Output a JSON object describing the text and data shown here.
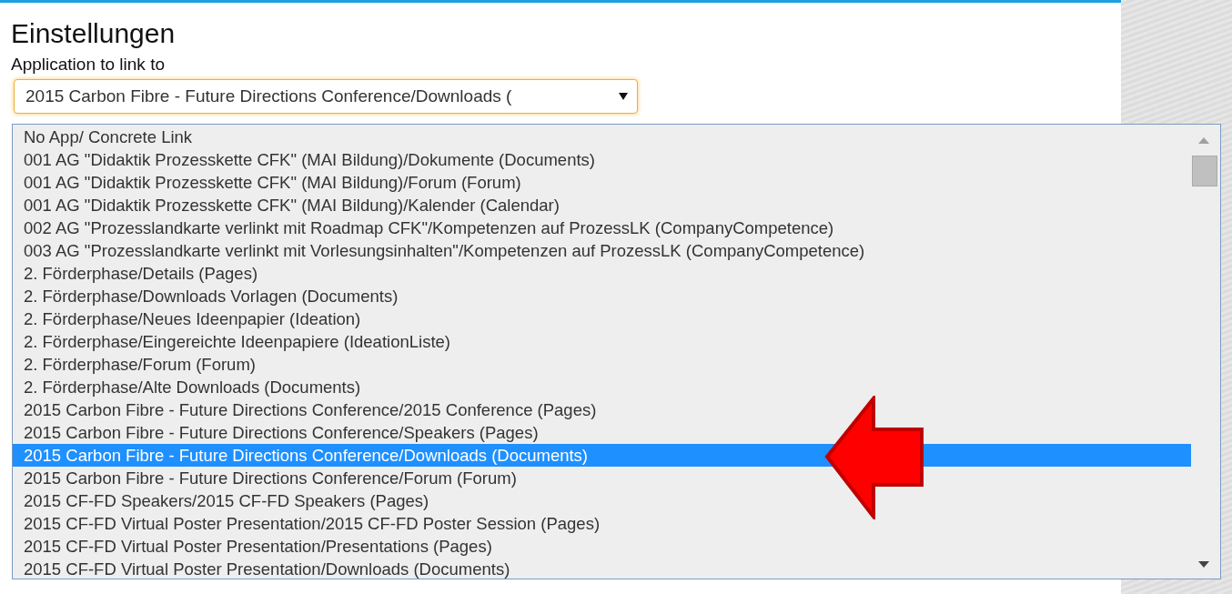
{
  "heading": "Einstellungen",
  "field": {
    "label": "Application to link to",
    "value": "2015 Carbon Fibre - Future Directions Conference/Downloads ("
  },
  "options": [
    {
      "label": "No App/ Concrete Link",
      "selected": false
    },
    {
      "label": "001 AG \"Didaktik Prozesskette CFK\" (MAI Bildung)/Dokumente (Documents)",
      "selected": false
    },
    {
      "label": "001 AG \"Didaktik Prozesskette CFK\" (MAI Bildung)/Forum (Forum)",
      "selected": false
    },
    {
      "label": "001 AG \"Didaktik Prozesskette CFK\" (MAI Bildung)/Kalender (Calendar)",
      "selected": false
    },
    {
      "label": "002 AG \"Prozesslandkarte verlinkt mit Roadmap CFK\"/Kompetenzen auf ProzessLK (CompanyCompetence)",
      "selected": false
    },
    {
      "label": "003 AG \"Prozesslandkarte verlinkt mit Vorlesungsinhalten\"/Kompetenzen auf ProzessLK (CompanyCompetence)",
      "selected": false
    },
    {
      "label": "2. Förderphase/Details (Pages)",
      "selected": false
    },
    {
      "label": "2. Förderphase/Downloads Vorlagen (Documents)",
      "selected": false
    },
    {
      "label": "2. Förderphase/Neues Ideenpapier (Ideation)",
      "selected": false
    },
    {
      "label": "2. Förderphase/Eingereichte Ideenpapiere (IdeationListe)",
      "selected": false
    },
    {
      "label": "2. Förderphase/Forum (Forum)",
      "selected": false
    },
    {
      "label": "2. Förderphase/Alte Downloads (Documents)",
      "selected": false
    },
    {
      "label": "2015 Carbon Fibre - Future Directions Conference/2015 Conference (Pages)",
      "selected": false
    },
    {
      "label": "2015 Carbon Fibre - Future Directions Conference/Speakers (Pages)",
      "selected": false
    },
    {
      "label": "2015 Carbon Fibre - Future Directions Conference/Downloads (Documents)",
      "selected": true
    },
    {
      "label": "2015 Carbon Fibre - Future Directions Conference/Forum (Forum)",
      "selected": false
    },
    {
      "label": "2015 CF-FD Speakers/2015 CF-FD Speakers (Pages)",
      "selected": false
    },
    {
      "label": "2015 CF-FD Virtual Poster Presentation/2015 CF-FD Poster Session (Pages)",
      "selected": false
    },
    {
      "label": "2015 CF-FD Virtual Poster Presentation/Presentations (Pages)",
      "selected": false
    },
    {
      "label": "2015 CF-FD Virtual Poster Presentation/Downloads (Documents)",
      "selected": false
    }
  ]
}
